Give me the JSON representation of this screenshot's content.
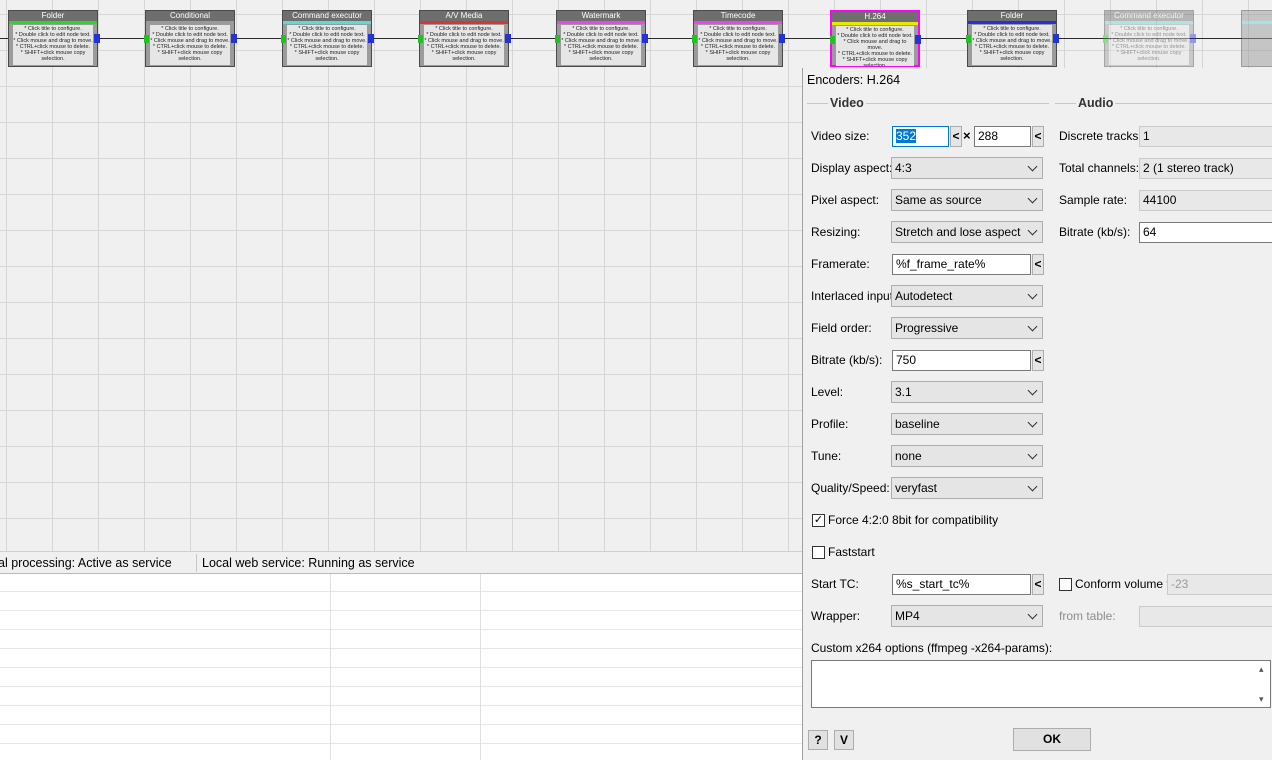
{
  "window": {
    "title": "Encoders: H.264"
  },
  "workflow": {
    "node_hint": "* Click title to configure.\n* Double click to edit node text.\n* Click mouse and drag to move.\n* CTRL+click mouse to delete.\n* SHIFT+click mouse copy selection.",
    "nodes": [
      {
        "title": "Folder",
        "color": "#22dd22"
      },
      {
        "title": "Conditional",
        "color": "#9a9a9a"
      },
      {
        "title": "Command executor",
        "color": "#55dddd"
      },
      {
        "title": "A/V Media",
        "color": "#dd3333"
      },
      {
        "title": "Watermark",
        "color": "#ee44ee"
      },
      {
        "title": "Timecode",
        "color": "#ee44ee"
      },
      {
        "title": "H.264",
        "color": "#e8e800"
      },
      {
        "title": "Folder",
        "color": "#2233dd"
      },
      {
        "title": "Command executor",
        "color": "#55dddd"
      }
    ]
  },
  "status": {
    "left": "al processing: Active as service",
    "right": "Local web service: Running as service"
  },
  "video": {
    "group_label": "Video",
    "video_size_label": "Video size:",
    "width": "352",
    "times": "×",
    "height": "288",
    "display_aspect_label": "Display aspect:",
    "display_aspect": "4:3",
    "pixel_aspect_label": "Pixel aspect:",
    "pixel_aspect": "Same as source",
    "resizing_label": "Resizing:",
    "resizing": "Stretch and lose aspect",
    "framerate_label": "Framerate:",
    "framerate": "%f_frame_rate%",
    "interlaced_label": "Interlaced input:",
    "interlaced": "Autodetect",
    "field_order_label": "Field order:",
    "field_order": "Progressive",
    "bitrate_label": "Bitrate (kb/s):",
    "bitrate": "750",
    "level_label": "Level:",
    "level": "3.1",
    "profile_label": "Profile:",
    "profile": "baseline",
    "tune_label": "Tune:",
    "tune": "none",
    "quality_label": "Quality/Speed:",
    "quality": "veryfast",
    "force_label": "Force 4:2:0 8bit for compatibility",
    "force_checked": "✓",
    "faststart_label": "Faststart",
    "start_tc_label": "Start TC:",
    "start_tc": "%s_start_tc%",
    "wrapper_label": "Wrapper:",
    "wrapper": "MP4",
    "custom_label": "Custom x264 options (ffmpeg -x264-params):",
    "custom_value": ""
  },
  "audio": {
    "group_label": "Audio",
    "tracks_label": "Discrete tracks:",
    "tracks": "1",
    "channels_label": "Total channels:",
    "channels": "2 (1 stereo track)",
    "sample_rate_label": "Sample rate:",
    "sample_rate": "44100",
    "bitrate_label": "Bitrate (kb/s):",
    "bitrate": "64",
    "conform_label": "Conform volume to",
    "conform_value": "-23",
    "from_table_label": "from table:"
  },
  "buttons": {
    "arrow": "<",
    "help": "?",
    "v": "V",
    "ok": "OK"
  }
}
